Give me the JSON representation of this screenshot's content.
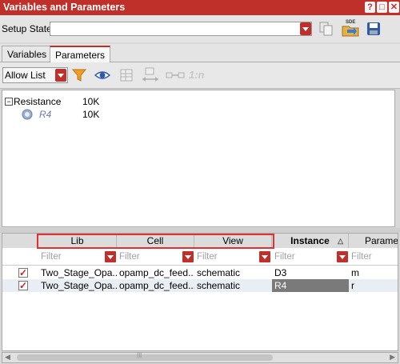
{
  "window": {
    "title": "Variables and Parameters"
  },
  "setup": {
    "label": "Setup State:",
    "value": ""
  },
  "tabs": [
    {
      "label": "Variables"
    },
    {
      "label": "Parameters"
    }
  ],
  "toolbar": {
    "filter_mode": "Allow List",
    "ratio_label": "1:n"
  },
  "tree": {
    "rows": [
      {
        "name": "Resistance",
        "value": "10K"
      },
      {
        "name": "R4",
        "value": "10K"
      }
    ]
  },
  "grid": {
    "columns": [
      {
        "label": "Lib"
      },
      {
        "label": "Cell"
      },
      {
        "label": "View"
      },
      {
        "label": "Instance"
      },
      {
        "label": "Parame"
      }
    ],
    "filter_placeholder": "Filter",
    "rows": [
      {
        "lib": "Two_Stage_Opa...",
        "cell": "opamp_dc_feed...",
        "view": "schematic",
        "instance": "D3",
        "param": "m"
      },
      {
        "lib": "Two_Stage_Opa...",
        "cell": "opamp_dc_feed...",
        "view": "schematic",
        "instance": "R4",
        "param": "r"
      }
    ]
  },
  "scrollbar": {
    "grip": "|||"
  }
}
